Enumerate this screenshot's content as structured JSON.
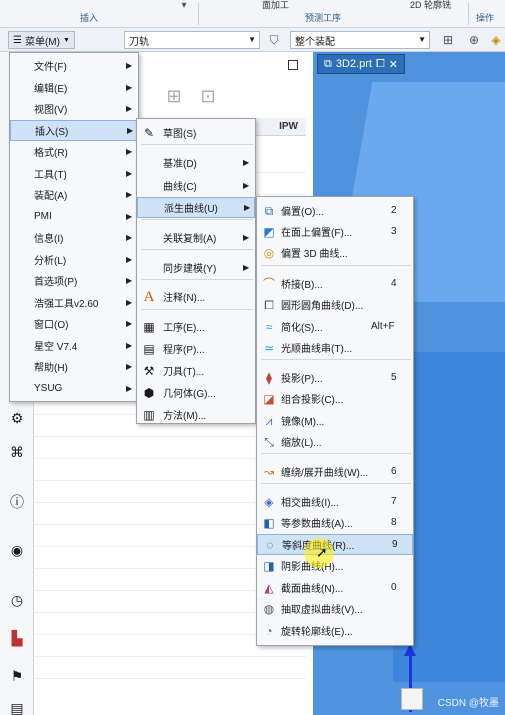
{
  "ribbon": {
    "top_items": [
      "面加工",
      "2D 轮廓铣"
    ],
    "groups": [
      "插入",
      "预测工序",
      "操作"
    ]
  },
  "toolbar": {
    "menu_label": "菜单(M)",
    "filter_value": "刀轨",
    "assembly_value": "整个装配"
  },
  "navigator": {
    "column_ipw": "IPW"
  },
  "graphics": {
    "tab_label": "3D2.prt",
    "watermark": "CSDN @牧墨"
  },
  "main_menu": [
    {
      "label": "文件(F)",
      "arrow": true
    },
    {
      "label": "编辑(E)",
      "arrow": true
    },
    {
      "label": "视图(V)",
      "arrow": true
    },
    {
      "label": "插入(S)",
      "arrow": true,
      "highlighted": true
    },
    {
      "label": "格式(R)",
      "arrow": true
    },
    {
      "label": "工具(T)",
      "arrow": true
    },
    {
      "label": "装配(A)",
      "arrow": true
    },
    {
      "label": "PMI",
      "arrow": true
    },
    {
      "label": "信息(I)",
      "arrow": true
    },
    {
      "label": "分析(L)",
      "arrow": true
    },
    {
      "label": "首选项(P)",
      "arrow": true
    },
    {
      "label": "浩强工具v2.60",
      "arrow": true
    },
    {
      "label": "窗口(O)",
      "arrow": true
    },
    {
      "label": "星空 V7.4",
      "arrow": true
    },
    {
      "label": "帮助(H)",
      "arrow": true
    },
    {
      "label": "YSUG",
      "arrow": true
    }
  ],
  "insert_menu": [
    {
      "label": "草图(S)",
      "icon": "sketch-icon",
      "arrow": false
    },
    {
      "label": "基准(D)",
      "icon": "",
      "arrow": true
    },
    {
      "label": "曲线(C)",
      "icon": "",
      "arrow": true
    },
    {
      "label": "派生曲线(U)",
      "icon": "",
      "arrow": true,
      "highlighted": true
    },
    {
      "label": "关联复制(A)",
      "icon": "",
      "arrow": true
    },
    {
      "label": "同步建模(Y)",
      "icon": "",
      "arrow": true
    },
    {
      "label": "注释(N)...",
      "icon": "annotation-icon",
      "arrow": false
    },
    {
      "label": "工序(E)...",
      "icon": "operation-icon",
      "arrow": false
    },
    {
      "label": "程序(P)...",
      "icon": "program-icon",
      "arrow": false
    },
    {
      "label": "刀具(T)...",
      "icon": "tool-icon",
      "arrow": false
    },
    {
      "label": "几何体(G)...",
      "icon": "geometry-icon",
      "arrow": false
    },
    {
      "label": "方法(M)...",
      "icon": "method-icon",
      "arrow": false
    }
  ],
  "derived_menu": [
    {
      "label": "偏置(O)...",
      "accel": "2",
      "icon": "offset-curve-icon"
    },
    {
      "label": "在面上偏置(F)...",
      "accel": "3",
      "icon": "offset-in-face-icon"
    },
    {
      "label": "偏置 3D 曲线...",
      "accel": "",
      "icon": "offset-3d-curve-icon"
    },
    {
      "label": "桥接(B)...",
      "accel": "4",
      "icon": "bridge-curve-icon"
    },
    {
      "label": "圆形圆角曲线(D)...",
      "accel": "",
      "icon": "circular-fillet-curve-icon"
    },
    {
      "label": "简化(S)...",
      "accel": "Alt+F",
      "icon": "simplify-icon"
    },
    {
      "label": "光顺曲线串(T)...",
      "accel": "",
      "icon": "smooth-curve-string-icon"
    },
    {
      "label": "投影(P)...",
      "accel": "5",
      "icon": "project-curve-icon"
    },
    {
      "label": "组合投影(C)...",
      "accel": "",
      "icon": "combined-projection-icon"
    },
    {
      "label": "镜像(M)...",
      "accel": "",
      "icon": "mirror-icon"
    },
    {
      "label": "缩放(L)...",
      "accel": "",
      "icon": "scale-icon"
    },
    {
      "label": "缠绕/展开曲线(W)...",
      "accel": "6",
      "icon": "wrap-unwrap-icon"
    },
    {
      "label": "相交曲线(I)...",
      "accel": "7",
      "icon": "intersection-curve-icon"
    },
    {
      "label": "等参数曲线(A)...",
      "accel": "8",
      "icon": "isoparametric-curve-icon"
    },
    {
      "label": "等斜度曲线(R)...",
      "accel": "9",
      "icon": "isocline-curve-icon",
      "highlighted": true
    },
    {
      "label": "阴影曲线(H)...",
      "accel": "",
      "icon": "shadow-curve-icon"
    },
    {
      "label": "截面曲线(N)...",
      "accel": "0",
      "icon": "section-curve-icon"
    },
    {
      "label": "抽取虚拟曲线(V)...",
      "accel": "",
      "icon": "extract-virtual-curve-icon"
    },
    {
      "label": "旋转轮廓线(E)...",
      "accel": "",
      "icon": "rotation-silhouette-icon"
    }
  ]
}
